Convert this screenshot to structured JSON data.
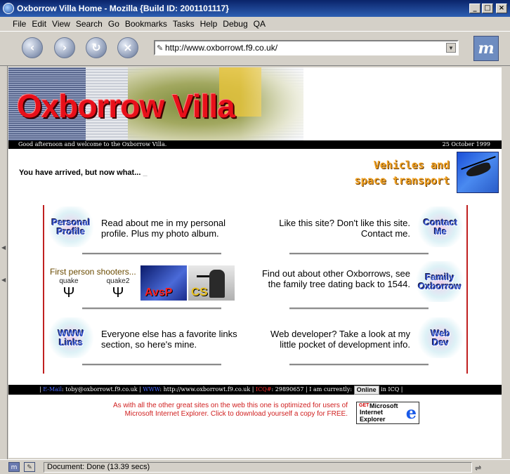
{
  "window": {
    "title": "Oxborrow Villa Home - Mozilla {Build ID: 2001101117}"
  },
  "menu": [
    "File",
    "Edit",
    "View",
    "Search",
    "Go",
    "Bookmarks",
    "Tasks",
    "Help",
    "Debug",
    "QA"
  ],
  "navigation": {
    "url": "http://www.oxborrowt.f9.co.uk/",
    "buttons": [
      "back",
      "forward",
      "reload",
      "stop"
    ]
  },
  "page": {
    "banner_title": "Oxborrow Villa",
    "welcome": "Good afternoon and welcome to the Oxborrow Villa.",
    "date": "25 October 1999",
    "arrived": "You have arrived, but now what...",
    "vehicles": {
      "line1": "Vehicles and",
      "line2": "space transport"
    },
    "sections": {
      "personal": {
        "badge_line1": "Personal",
        "badge_line2": "Profile",
        "text": "Read about me in my personal profile.  Plus my photo album."
      },
      "contact": {
        "badge_line1": "Contact",
        "badge_line2": "Me",
        "text": "Like this site? Don't like this site. Contact me."
      },
      "shooters": {
        "title": "First person shooters...",
        "quake": "quake",
        "quake2": "quake2",
        "avp": "AvsP",
        "cs": "CS"
      },
      "family": {
        "badge_line1": "Family",
        "badge_line2": "Oxborrow",
        "text": "Find out about other Oxborrows, see the family tree dating back to 1544."
      },
      "links": {
        "badge_line1": "WWW",
        "badge_line2": "Links",
        "text": "Everyone else has a favorite links section, so here's mine."
      },
      "webdev": {
        "badge_line1": "Web",
        "badge_line2": "Dev",
        "text": "Web developer? Take a look at my little pocket of development info."
      }
    },
    "footer": {
      "email_label": "E-Mail",
      "email": "toby@oxborrowt.f9.co.uk",
      "www_label": "WWW",
      "www": "http://www.oxborrowt.f9.co.uk",
      "icq_label": "ICQ#",
      "icq": "29890657",
      "currently": "I am currently:",
      "online": "Online",
      "in_icq": "in ICQ"
    },
    "ie_note": "As with all the other great sites on the web this one is optimized for users of Microsoft Internet Explorer. Click to download yourself a copy for FREE.",
    "ie_badge": {
      "get": "GET",
      "microsoft": "Microsoft",
      "ie_line1": "Internet",
      "ie_line2": "Explorer"
    }
  },
  "status": {
    "text": "Document: Done (13.39 secs)"
  },
  "colors": {
    "titlebar": "#0a246a",
    "banner_title": "#e8101a",
    "vehicles": "#f0a020",
    "frame": "#c02020",
    "badge": "#3050c8",
    "ie_note": "#d02020"
  }
}
